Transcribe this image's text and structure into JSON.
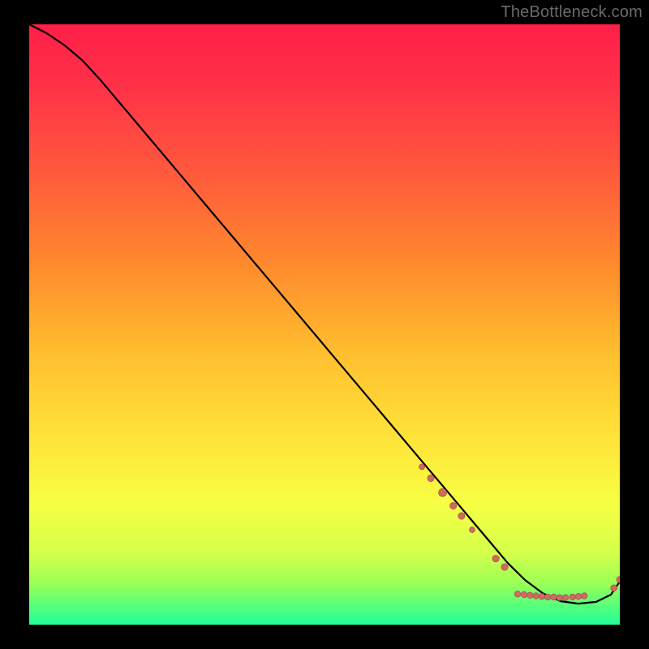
{
  "watermark": "TheBottleneck.com",
  "colors": {
    "page_bg": "#000000",
    "watermark": "#6a6a6a",
    "curve": "#000000",
    "dot_fill": "#cf6a61",
    "dot_stroke": "#9a4b44",
    "green_band": "#33ff85",
    "green_mid": "#79ff72",
    "greenish_yellow": "#d4ff4a",
    "yellow": "#ffe63a",
    "orange": "#ff8a2d",
    "red": "#ff2a4d"
  },
  "chart_data": {
    "type": "line",
    "title": "",
    "xlabel": "",
    "ylabel": "",
    "xlim": [
      0,
      100
    ],
    "ylim": [
      0,
      100
    ],
    "x": [
      0.0,
      3.0,
      6.0,
      9.0,
      12.0,
      15.0,
      18.0,
      21.0,
      24.0,
      27.0,
      30.0,
      33.0,
      36.0,
      39.0,
      42.0,
      45.0,
      48.0,
      51.0,
      54.0,
      57.0,
      60.0,
      63.0,
      66.0,
      69.0,
      72.0,
      75.0,
      78.0,
      81.0,
      84.0,
      87.0,
      90.0,
      93.0,
      96.0,
      98.5,
      100.0
    ],
    "y": [
      100.0,
      98.5,
      96.5,
      94.0,
      90.8,
      87.3,
      83.8,
      80.3,
      76.8,
      73.3,
      69.8,
      66.3,
      62.8,
      59.3,
      55.8,
      52.3,
      48.8,
      45.3,
      41.8,
      38.3,
      34.8,
      31.3,
      27.8,
      24.3,
      20.8,
      17.3,
      13.8,
      10.3,
      7.4,
      5.2,
      3.9,
      3.5,
      3.8,
      5.0,
      7.2
    ],
    "dots": [
      {
        "x": 66.5,
        "y": 26.3,
        "r": 3.5
      },
      {
        "x": 68.0,
        "y": 24.4,
        "r": 4.2
      },
      {
        "x": 70.0,
        "y": 22.0,
        "r": 5.0
      },
      {
        "x": 71.8,
        "y": 19.8,
        "r": 4.2
      },
      {
        "x": 73.2,
        "y": 18.1,
        "r": 4.2
      },
      {
        "x": 75.0,
        "y": 15.8,
        "r": 3.5
      },
      {
        "x": 79.0,
        "y": 11.0,
        "r": 4.2
      },
      {
        "x": 80.5,
        "y": 9.6,
        "r": 4.2
      },
      {
        "x": 82.7,
        "y": 5.1,
        "r": 3.8
      },
      {
        "x": 83.8,
        "y": 5.0,
        "r": 3.8
      },
      {
        "x": 84.8,
        "y": 4.9,
        "r": 3.8
      },
      {
        "x": 85.8,
        "y": 4.8,
        "r": 3.8
      },
      {
        "x": 86.8,
        "y": 4.7,
        "r": 3.8
      },
      {
        "x": 87.8,
        "y": 4.6,
        "r": 3.8
      },
      {
        "x": 88.8,
        "y": 4.6,
        "r": 3.8
      },
      {
        "x": 89.8,
        "y": 4.5,
        "r": 3.8
      },
      {
        "x": 90.8,
        "y": 4.5,
        "r": 3.8
      },
      {
        "x": 92.0,
        "y": 4.6,
        "r": 3.8
      },
      {
        "x": 93.0,
        "y": 4.7,
        "r": 3.8
      },
      {
        "x": 94.0,
        "y": 4.8,
        "r": 3.8
      },
      {
        "x": 99.0,
        "y": 6.1,
        "r": 4.0
      },
      {
        "x": 100.0,
        "y": 7.5,
        "r": 4.0
      }
    ]
  }
}
